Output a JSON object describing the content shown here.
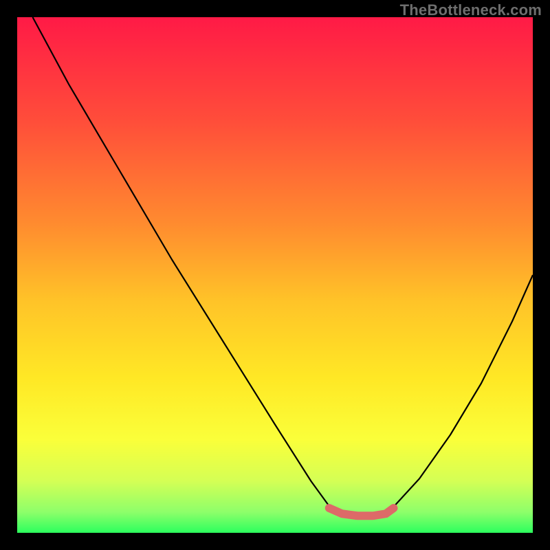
{
  "watermark": "TheBottleneck.com",
  "chart_data": {
    "type": "line",
    "title": "",
    "xlabel": "",
    "ylabel": "",
    "xlim": [
      0,
      100
    ],
    "ylim": [
      0,
      100
    ],
    "grid": false,
    "legend": false,
    "background_gradient": {
      "stops": [
        {
          "offset": 0.0,
          "color": "#ff1a46"
        },
        {
          "offset": 0.2,
          "color": "#ff4d3a"
        },
        {
          "offset": 0.4,
          "color": "#ff8b2f"
        },
        {
          "offset": 0.55,
          "color": "#ffc328"
        },
        {
          "offset": 0.7,
          "color": "#ffe825"
        },
        {
          "offset": 0.82,
          "color": "#faff3a"
        },
        {
          "offset": 0.9,
          "color": "#d4ff55"
        },
        {
          "offset": 0.96,
          "color": "#8dff6a"
        },
        {
          "offset": 1.0,
          "color": "#2cff5e"
        }
      ]
    },
    "series": [
      {
        "name": "curve-left",
        "color": "#000000",
        "width": 2.2,
        "x": [
          3.0,
          10.0,
          20.0,
          30.0,
          40.0,
          50.0,
          57.0,
          61.0
        ],
        "y": [
          100.0,
          87.0,
          70.0,
          53.0,
          37.0,
          21.0,
          10.0,
          4.5
        ]
      },
      {
        "name": "curve-right",
        "color": "#000000",
        "width": 2.2,
        "x": [
          72.5,
          78.0,
          84.0,
          90.0,
          96.0,
          100.0
        ],
        "y": [
          4.5,
          10.5,
          19.0,
          29.0,
          41.0,
          50.0
        ]
      },
      {
        "name": "valley-marker",
        "color": "#dd6a68",
        "width": 12,
        "linecap": "round",
        "x": [
          60.5,
          63.0,
          66.0,
          69.0,
          71.5,
          73.0
        ],
        "y": [
          4.8,
          3.7,
          3.3,
          3.3,
          3.7,
          4.8
        ]
      }
    ]
  }
}
